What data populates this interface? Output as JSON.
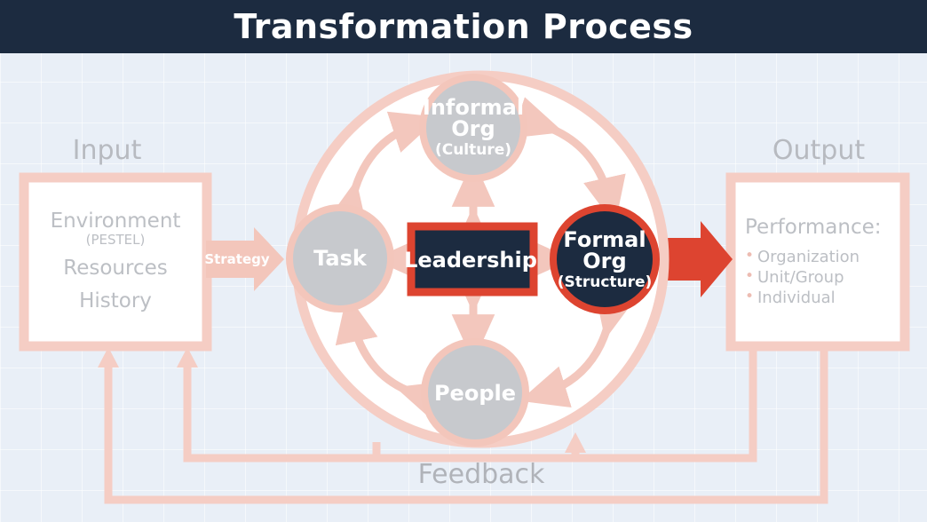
{
  "header": {
    "title": "Transformation Process"
  },
  "colors": {
    "header_bg": "#1c2b40",
    "page_bg": "#e9eff7",
    "pink": "#f5cdc4",
    "pink_strong": "#f2c2b7",
    "red": "#dd4430",
    "navy": "#1c2b40",
    "gray_circle": "#c7c9cd",
    "text_gray": "#bcbfc4",
    "white": "#ffffff"
  },
  "input": {
    "label": "Input",
    "lines": [
      {
        "text": "Environment",
        "size": "big"
      },
      {
        "text": "(PESTEL)",
        "size": "small"
      },
      {
        "text": "Resources",
        "size": "big"
      },
      {
        "text": "History",
        "size": "big"
      }
    ]
  },
  "strategy_arrow": {
    "label": "Strategy"
  },
  "transformation": {
    "nodes": [
      {
        "id": "informal-org",
        "line1": "Informal",
        "line2": "Org",
        "sub": "(Culture)",
        "style": "gray-circle"
      },
      {
        "id": "task",
        "line1": "Task",
        "style": "gray-circle"
      },
      {
        "id": "people",
        "line1": "People",
        "style": "gray-circle"
      },
      {
        "id": "formal-org",
        "line1": "Formal",
        "line2": "Org",
        "sub": "(Structure)",
        "style": "navy-circle"
      },
      {
        "id": "leadership",
        "line1": "Leadership",
        "style": "navy-box"
      }
    ]
  },
  "output": {
    "label": "Output",
    "heading": "Performance:",
    "items": [
      "Organization",
      "Unit/Group",
      "Individual"
    ]
  },
  "feedback": {
    "label": "Feedback"
  }
}
